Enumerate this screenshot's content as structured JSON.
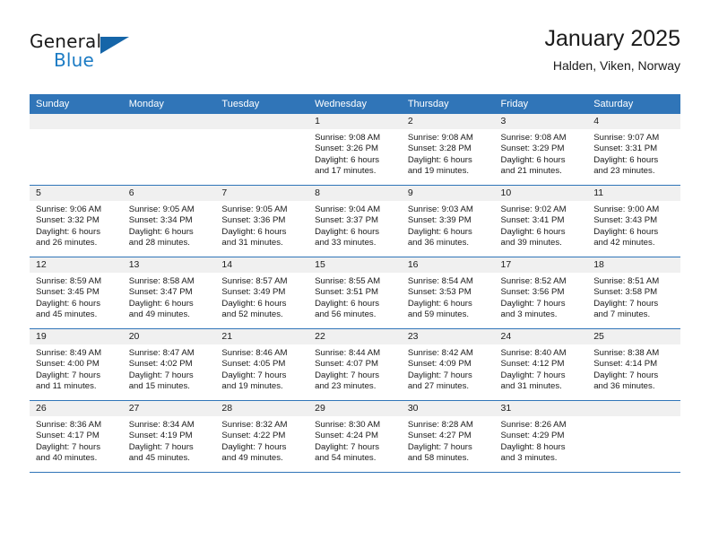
{
  "brand": {
    "name_primary": "General",
    "name_secondary": "Blue",
    "accent_color": "#1b7bc4",
    "triangle_color": "#1565a8"
  },
  "header": {
    "title": "January 2025",
    "subtitle": "Halden, Viken, Norway",
    "header_bar_color": "#3075b8"
  },
  "weekdays": [
    "Sunday",
    "Monday",
    "Tuesday",
    "Wednesday",
    "Thursday",
    "Friday",
    "Saturday"
  ],
  "labels": {
    "sunrise": "Sunrise:",
    "sunset": "Sunset:",
    "daylight": "Daylight:"
  },
  "weeks": [
    [
      {
        "day": "",
        "line1": "",
        "line2": "",
        "line3": "",
        "line4": "",
        "empty": true
      },
      {
        "day": "",
        "line1": "",
        "line2": "",
        "line3": "",
        "line4": "",
        "empty": true
      },
      {
        "day": "",
        "line1": "",
        "line2": "",
        "line3": "",
        "line4": "",
        "empty": true
      },
      {
        "day": "1",
        "line1": "Sunrise: 9:08 AM",
        "line2": "Sunset: 3:26 PM",
        "line3": "Daylight: 6 hours",
        "line4": "and 17 minutes."
      },
      {
        "day": "2",
        "line1": "Sunrise: 9:08 AM",
        "line2": "Sunset: 3:28 PM",
        "line3": "Daylight: 6 hours",
        "line4": "and 19 minutes."
      },
      {
        "day": "3",
        "line1": "Sunrise: 9:08 AM",
        "line2": "Sunset: 3:29 PM",
        "line3": "Daylight: 6 hours",
        "line4": "and 21 minutes."
      },
      {
        "day": "4",
        "line1": "Sunrise: 9:07 AM",
        "line2": "Sunset: 3:31 PM",
        "line3": "Daylight: 6 hours",
        "line4": "and 23 minutes."
      }
    ],
    [
      {
        "day": "5",
        "line1": "Sunrise: 9:06 AM",
        "line2": "Sunset: 3:32 PM",
        "line3": "Daylight: 6 hours",
        "line4": "and 26 minutes."
      },
      {
        "day": "6",
        "line1": "Sunrise: 9:05 AM",
        "line2": "Sunset: 3:34 PM",
        "line3": "Daylight: 6 hours",
        "line4": "and 28 minutes."
      },
      {
        "day": "7",
        "line1": "Sunrise: 9:05 AM",
        "line2": "Sunset: 3:36 PM",
        "line3": "Daylight: 6 hours",
        "line4": "and 31 minutes."
      },
      {
        "day": "8",
        "line1": "Sunrise: 9:04 AM",
        "line2": "Sunset: 3:37 PM",
        "line3": "Daylight: 6 hours",
        "line4": "and 33 minutes."
      },
      {
        "day": "9",
        "line1": "Sunrise: 9:03 AM",
        "line2": "Sunset: 3:39 PM",
        "line3": "Daylight: 6 hours",
        "line4": "and 36 minutes."
      },
      {
        "day": "10",
        "line1": "Sunrise: 9:02 AM",
        "line2": "Sunset: 3:41 PM",
        "line3": "Daylight: 6 hours",
        "line4": "and 39 minutes."
      },
      {
        "day": "11",
        "line1": "Sunrise: 9:00 AM",
        "line2": "Sunset: 3:43 PM",
        "line3": "Daylight: 6 hours",
        "line4": "and 42 minutes."
      }
    ],
    [
      {
        "day": "12",
        "line1": "Sunrise: 8:59 AM",
        "line2": "Sunset: 3:45 PM",
        "line3": "Daylight: 6 hours",
        "line4": "and 45 minutes."
      },
      {
        "day": "13",
        "line1": "Sunrise: 8:58 AM",
        "line2": "Sunset: 3:47 PM",
        "line3": "Daylight: 6 hours",
        "line4": "and 49 minutes."
      },
      {
        "day": "14",
        "line1": "Sunrise: 8:57 AM",
        "line2": "Sunset: 3:49 PM",
        "line3": "Daylight: 6 hours",
        "line4": "and 52 minutes."
      },
      {
        "day": "15",
        "line1": "Sunrise: 8:55 AM",
        "line2": "Sunset: 3:51 PM",
        "line3": "Daylight: 6 hours",
        "line4": "and 56 minutes."
      },
      {
        "day": "16",
        "line1": "Sunrise: 8:54 AM",
        "line2": "Sunset: 3:53 PM",
        "line3": "Daylight: 6 hours",
        "line4": "and 59 minutes."
      },
      {
        "day": "17",
        "line1": "Sunrise: 8:52 AM",
        "line2": "Sunset: 3:56 PM",
        "line3": "Daylight: 7 hours",
        "line4": "and 3 minutes."
      },
      {
        "day": "18",
        "line1": "Sunrise: 8:51 AM",
        "line2": "Sunset: 3:58 PM",
        "line3": "Daylight: 7 hours",
        "line4": "and 7 minutes."
      }
    ],
    [
      {
        "day": "19",
        "line1": "Sunrise: 8:49 AM",
        "line2": "Sunset: 4:00 PM",
        "line3": "Daylight: 7 hours",
        "line4": "and 11 minutes."
      },
      {
        "day": "20",
        "line1": "Sunrise: 8:47 AM",
        "line2": "Sunset: 4:02 PM",
        "line3": "Daylight: 7 hours",
        "line4": "and 15 minutes."
      },
      {
        "day": "21",
        "line1": "Sunrise: 8:46 AM",
        "line2": "Sunset: 4:05 PM",
        "line3": "Daylight: 7 hours",
        "line4": "and 19 minutes."
      },
      {
        "day": "22",
        "line1": "Sunrise: 8:44 AM",
        "line2": "Sunset: 4:07 PM",
        "line3": "Daylight: 7 hours",
        "line4": "and 23 minutes."
      },
      {
        "day": "23",
        "line1": "Sunrise: 8:42 AM",
        "line2": "Sunset: 4:09 PM",
        "line3": "Daylight: 7 hours",
        "line4": "and 27 minutes."
      },
      {
        "day": "24",
        "line1": "Sunrise: 8:40 AM",
        "line2": "Sunset: 4:12 PM",
        "line3": "Daylight: 7 hours",
        "line4": "and 31 minutes."
      },
      {
        "day": "25",
        "line1": "Sunrise: 8:38 AM",
        "line2": "Sunset: 4:14 PM",
        "line3": "Daylight: 7 hours",
        "line4": "and 36 minutes."
      }
    ],
    [
      {
        "day": "26",
        "line1": "Sunrise: 8:36 AM",
        "line2": "Sunset: 4:17 PM",
        "line3": "Daylight: 7 hours",
        "line4": "and 40 minutes."
      },
      {
        "day": "27",
        "line1": "Sunrise: 8:34 AM",
        "line2": "Sunset: 4:19 PM",
        "line3": "Daylight: 7 hours",
        "line4": "and 45 minutes."
      },
      {
        "day": "28",
        "line1": "Sunrise: 8:32 AM",
        "line2": "Sunset: 4:22 PM",
        "line3": "Daylight: 7 hours",
        "line4": "and 49 minutes."
      },
      {
        "day": "29",
        "line1": "Sunrise: 8:30 AM",
        "line2": "Sunset: 4:24 PM",
        "line3": "Daylight: 7 hours",
        "line4": "and 54 minutes."
      },
      {
        "day": "30",
        "line1": "Sunrise: 8:28 AM",
        "line2": "Sunset: 4:27 PM",
        "line3": "Daylight: 7 hours",
        "line4": "and 58 minutes."
      },
      {
        "day": "31",
        "line1": "Sunrise: 8:26 AM",
        "line2": "Sunset: 4:29 PM",
        "line3": "Daylight: 8 hours",
        "line4": "and 3 minutes."
      },
      {
        "day": "",
        "line1": "",
        "line2": "",
        "line3": "",
        "line4": "",
        "empty": true
      }
    ]
  ]
}
